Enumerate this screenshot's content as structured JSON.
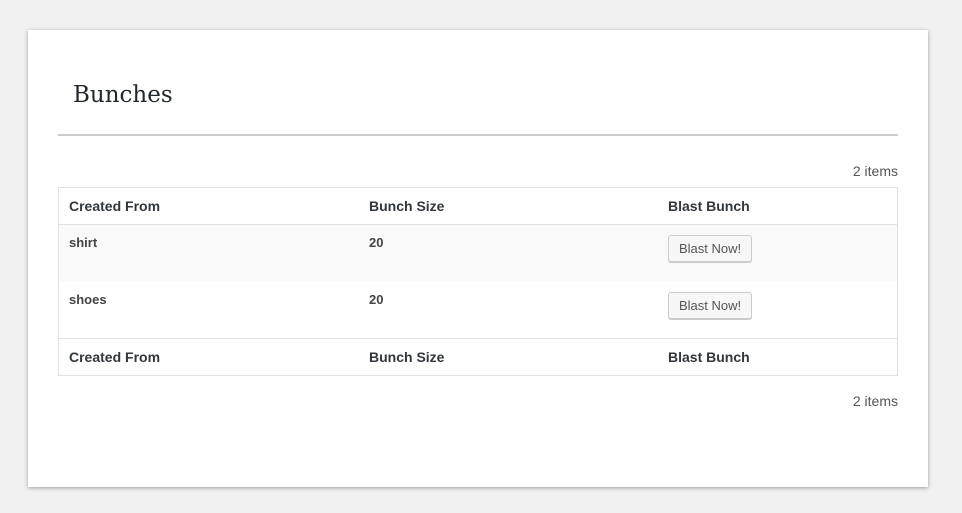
{
  "page": {
    "title": "Bunches",
    "item_count_top": "2 items",
    "item_count_bottom": "2 items"
  },
  "table": {
    "headers": [
      "Created From",
      "Bunch Size",
      "Blast Bunch"
    ],
    "footers": [
      "Created From",
      "Bunch Size",
      "Blast Bunch"
    ],
    "rows": [
      {
        "created_from": "shirt",
        "bunch_size": "20",
        "action_label": "Blast Now!"
      },
      {
        "created_from": "shoes",
        "bunch_size": "20",
        "action_label": "Blast Now!"
      }
    ]
  },
  "colors": {
    "background": "#f1f1f1",
    "card": "#ffffff",
    "alt_row": "#f9f9f9",
    "border": "#e1e1e1"
  }
}
